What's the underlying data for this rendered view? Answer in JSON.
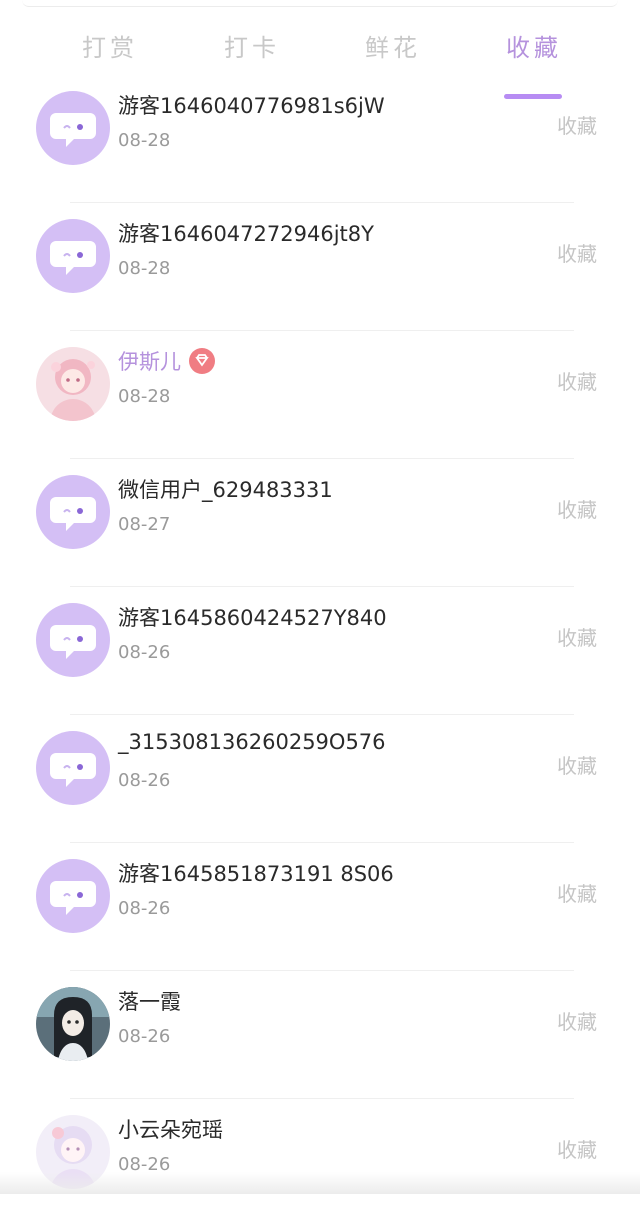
{
  "tabs": [
    {
      "label": "打赏",
      "active": false
    },
    {
      "label": "打卡",
      "active": false
    },
    {
      "label": "鲜花",
      "active": false
    },
    {
      "label": "收藏",
      "active": true
    }
  ],
  "colors": {
    "accent": "#b78cf3",
    "avatar_bg": "#d4bff5",
    "vip": "#f07d83"
  },
  "list": {
    "items": [
      {
        "name": "游客1646040776981s6jW",
        "date": "08-28",
        "action": "收藏",
        "avatar": "chat-bubble-icon"
      },
      {
        "name": "游客1646047272946jt8Y",
        "date": "08-28",
        "action": "收藏",
        "avatar": "chat-bubble-icon"
      },
      {
        "name": "伊斯儿",
        "date": "08-28",
        "action": "收藏",
        "avatar": "user-photo",
        "vip": true
      },
      {
        "name": "微信用户_629483331",
        "date": "08-27",
        "action": "收藏",
        "avatar": "chat-bubble-icon"
      },
      {
        "name": "游客1645860424527Y840",
        "date": "08-26",
        "action": "收藏",
        "avatar": "chat-bubble-icon"
      },
      {
        "name": "_315308136260259O576",
        "date": "08-26",
        "action": "收藏",
        "avatar": "chat-bubble-icon"
      },
      {
        "name": "游客1645851873191 8S06",
        "date": "08-26",
        "action": "收藏",
        "avatar": "chat-bubble-icon"
      },
      {
        "name": "落一霞",
        "date": "08-26",
        "action": "收藏",
        "avatar": "user-photo"
      },
      {
        "name": "小云朵宛瑶",
        "date": "08-26",
        "action": "收藏",
        "avatar": "user-photo"
      }
    ]
  }
}
